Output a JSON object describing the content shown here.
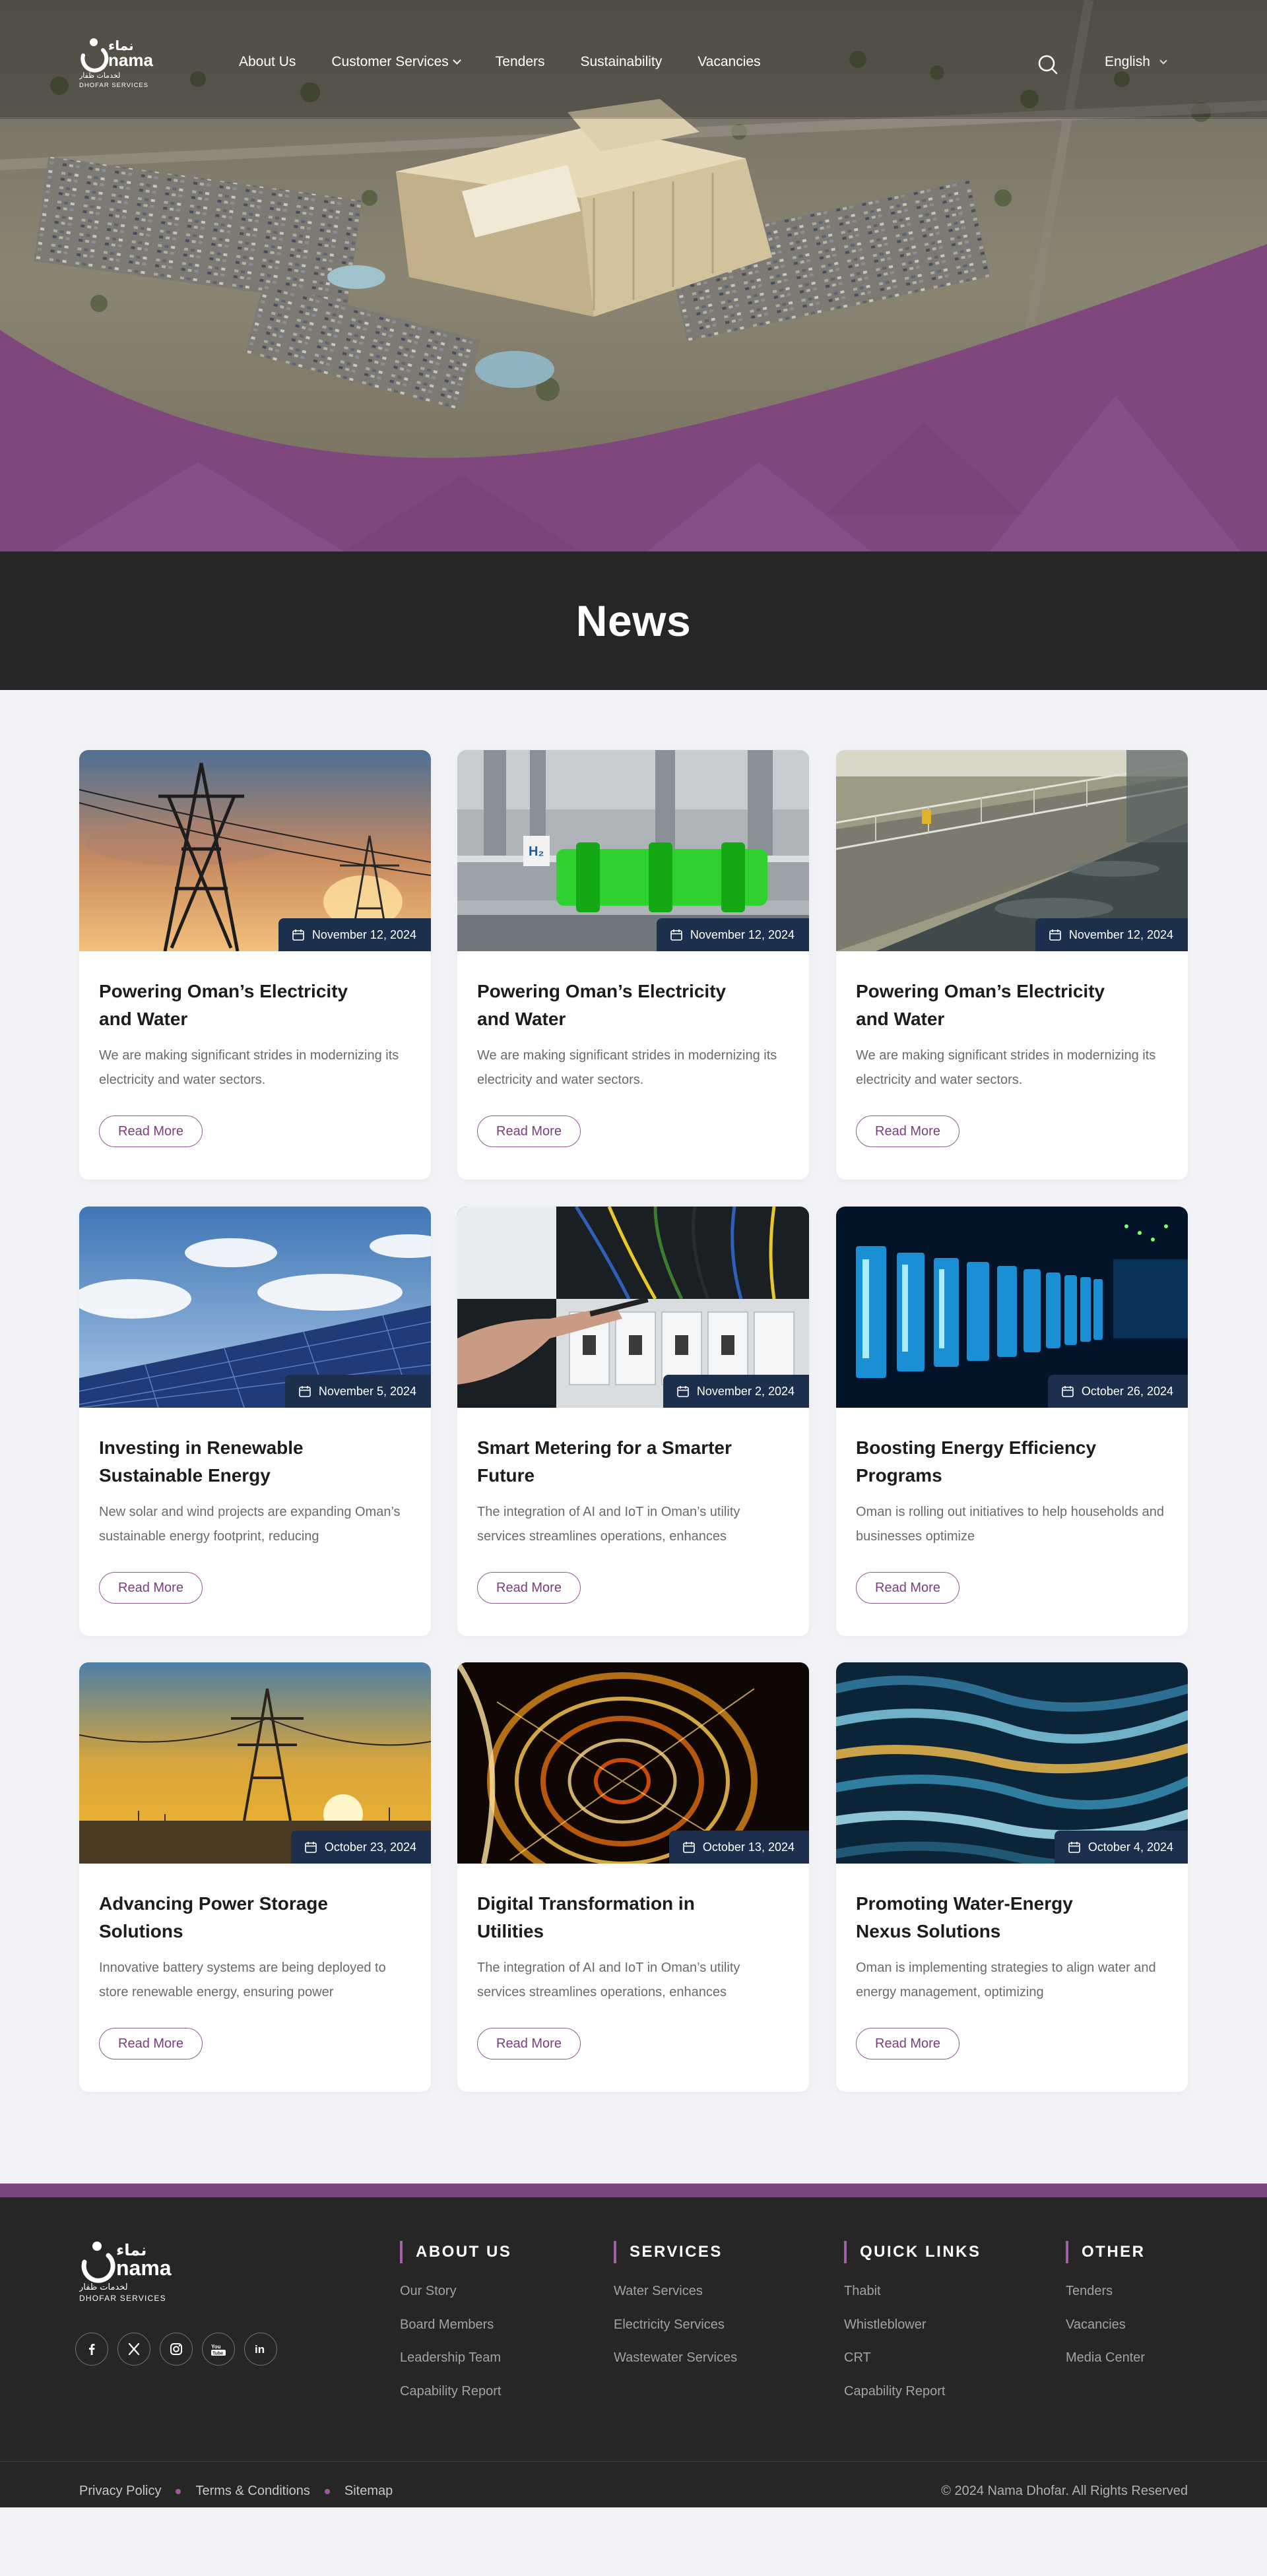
{
  "header": {
    "logo": {
      "arabic": "نماء",
      "latin": "nama",
      "arabic_sub": "لخدمات ظفار",
      "sub": "DHOFAR SERVICES"
    },
    "nav": [
      {
        "label": "About Us"
      },
      {
        "label": "Customer Services",
        "has_dropdown": true
      },
      {
        "label": "Tenders"
      },
      {
        "label": "Sustainability"
      },
      {
        "label": "Vacancies"
      }
    ],
    "search_icon": "search-icon",
    "language": "English"
  },
  "page_title": "News",
  "news": [
    {
      "image": "power-lines-sunset",
      "date": "November 12, 2024",
      "title": "Powering Oman’s Electricity and Water",
      "excerpt": "We are making significant strides in modernizing its electricity and water sectors.",
      "button": "Read More"
    },
    {
      "image": "hydrogen-pipes",
      "date": "November 12, 2024",
      "title": "Powering Oman’s Electricity and Water",
      "excerpt": "We are making significant strides in modernizing its electricity and water sectors.",
      "button": "Read More"
    },
    {
      "image": "water-treatment",
      "date": "November 12, 2024",
      "title": "Powering Oman’s Electricity and Water",
      "excerpt": "We are making significant strides in modernizing its electricity and water sectors.",
      "button": "Read More"
    },
    {
      "image": "solar-panels",
      "date": "November 5, 2024",
      "title": "Investing in Renewable Sustainable Energy",
      "excerpt": "New solar and wind projects are expanding Oman’s sustainable energy footprint, reducing",
      "button": "Read More"
    },
    {
      "image": "electric-panel",
      "date": "November 2, 2024",
      "title": "Smart Metering for a Smarter Future",
      "excerpt": "The integration of AI and IoT in Oman’s utility services streamlines operations, enhances",
      "button": "Read More"
    },
    {
      "image": "server-room",
      "date": "October 26, 2024",
      "title": "Boosting Energy Efficiency Programs",
      "excerpt": "Oman is rolling out initiatives to help households and businesses optimize",
      "button": "Read More"
    },
    {
      "image": "pylon-sunset",
      "date": "October 23, 2024",
      "title": "Advancing Power Storage Solutions",
      "excerpt": "Innovative battery systems are being deployed to store renewable energy, ensuring power",
      "button": "Read More"
    },
    {
      "image": "light-trails",
      "date": "October 13, 2024",
      "title": "Digital Transformation in Utilities",
      "excerpt": "The integration of AI and IoT in Oman’s utility services streamlines operations, enhances",
      "button": "Read More"
    },
    {
      "image": "water-waves",
      "date": "October 4, 2024",
      "title": "Promoting Water-Energy Nexus Solutions",
      "excerpt": "Oman is implementing strategies to align water and energy management, optimizing",
      "button": "Read More"
    }
  ],
  "footer": {
    "logo": {
      "arabic": "نماء",
      "latin": "nama",
      "arabic_sub": "لخدمات ظفار",
      "sub": "DHOFAR SERVICES"
    },
    "socials": [
      "facebook-icon",
      "x-icon",
      "instagram-icon",
      "youtube-icon",
      "linkedin-icon"
    ],
    "columns": [
      {
        "title": "ABOUT US",
        "links": [
          "Our Story",
          "Board Members",
          "Leadership Team",
          "Capability Report"
        ]
      },
      {
        "title": "SERVICES",
        "links": [
          "Water Services",
          "Electricity Services",
          "Wastewater Services"
        ]
      },
      {
        "title": "QUICK LINKS",
        "links": [
          "Thabit",
          "Whistleblower",
          "CRT",
          "Capability Report"
        ]
      },
      {
        "title": "OTHER",
        "links": [
          "Tenders",
          "Vacancies",
          "Media Center"
        ]
      }
    ],
    "legal": [
      "Privacy Policy",
      "Terms & Conditions",
      "Sitemap"
    ],
    "copyright": "© 2024 Nama Dhofar. All Rights Reserved"
  },
  "colors": {
    "brand_purple": "#7b4780",
    "badge_navy": "#1c2f4c",
    "dark_band": "#262626",
    "page_bg": "#f2f3f6"
  }
}
